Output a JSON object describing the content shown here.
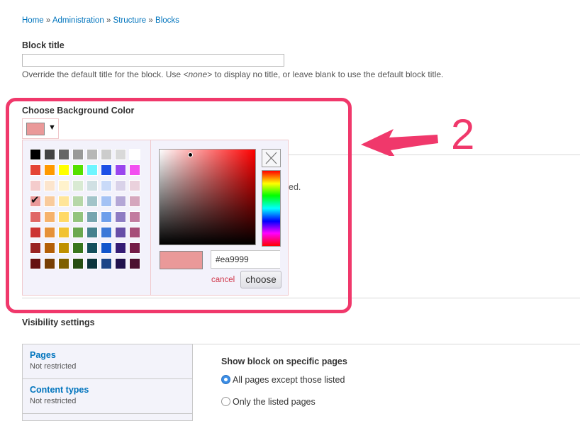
{
  "breadcrumb": {
    "items": [
      "Home",
      "Administration",
      "Structure",
      "Blocks"
    ],
    "separator": "»"
  },
  "block_title": {
    "label": "Block title",
    "value": "",
    "description_before": "Override the default title for the block. Use ",
    "description_code": "<none>",
    "description_after": " to display no title, or leave blank to use the default block title."
  },
  "bg_color": {
    "label": "Choose Background Color",
    "current_color": "#ea9999",
    "dropdown_icon": "triangle-down",
    "obscured_text": "ed."
  },
  "color_picker": {
    "palette": [
      [
        "#000000",
        "#434343",
        "#666666",
        "#999999",
        "#b7b7b7",
        "#cccccc",
        "#d9d9d9",
        "#ffffff"
      ],
      [
        "#e44436",
        "#ff9900",
        "#ffff00",
        "#55e000",
        "#6ef5ff",
        "#1d4fe6",
        "#9a45ee",
        "#f24ff0"
      ],
      [
        "#f4cccc",
        "#fce5cd",
        "#fff2cc",
        "#d9ead3",
        "#d0e0e3",
        "#c9daf8",
        "#d9d2e9",
        "#ead1dc"
      ],
      [
        "#ea9999",
        "#f9cb9c",
        "#ffe599",
        "#b6d7a8",
        "#a2c4c9",
        "#a4c2f4",
        "#b4a7d6",
        "#d5a6bd"
      ],
      [
        "#e06666",
        "#f6b26b",
        "#ffd966",
        "#93c47d",
        "#76a5af",
        "#6d9eeb",
        "#8e7cc3",
        "#c27ba0"
      ],
      [
        "#cc3333",
        "#e69138",
        "#f1c232",
        "#6aa84f",
        "#45818e",
        "#3c78d8",
        "#674ea7",
        "#a64d79"
      ],
      [
        "#992222",
        "#b45f06",
        "#bf9000",
        "#38761d",
        "#134f5c",
        "#1155cc",
        "#351c75",
        "#741b47"
      ],
      [
        "#661111",
        "#783f04",
        "#7f6000",
        "#274e13",
        "#0c343d",
        "#1c4587",
        "#20124d",
        "#4c1130"
      ]
    ],
    "selected": "#ea9999",
    "hex_value": "#ea9999",
    "close_icon": "close-x",
    "cancel_label": "cancel",
    "choose_label": "choose"
  },
  "annotation": {
    "number": "2",
    "color": "#f0386b"
  },
  "visibility": {
    "label": "Visibility settings",
    "tabs": [
      {
        "title": "Pages",
        "summary": "Not restricted"
      },
      {
        "title": "Content types",
        "summary": "Not restricted"
      }
    ],
    "pages": {
      "heading": "Show block on specific pages",
      "options": [
        {
          "label": "All pages except those listed",
          "checked": true
        },
        {
          "label": "Only the listed pages",
          "checked": false
        }
      ]
    }
  }
}
